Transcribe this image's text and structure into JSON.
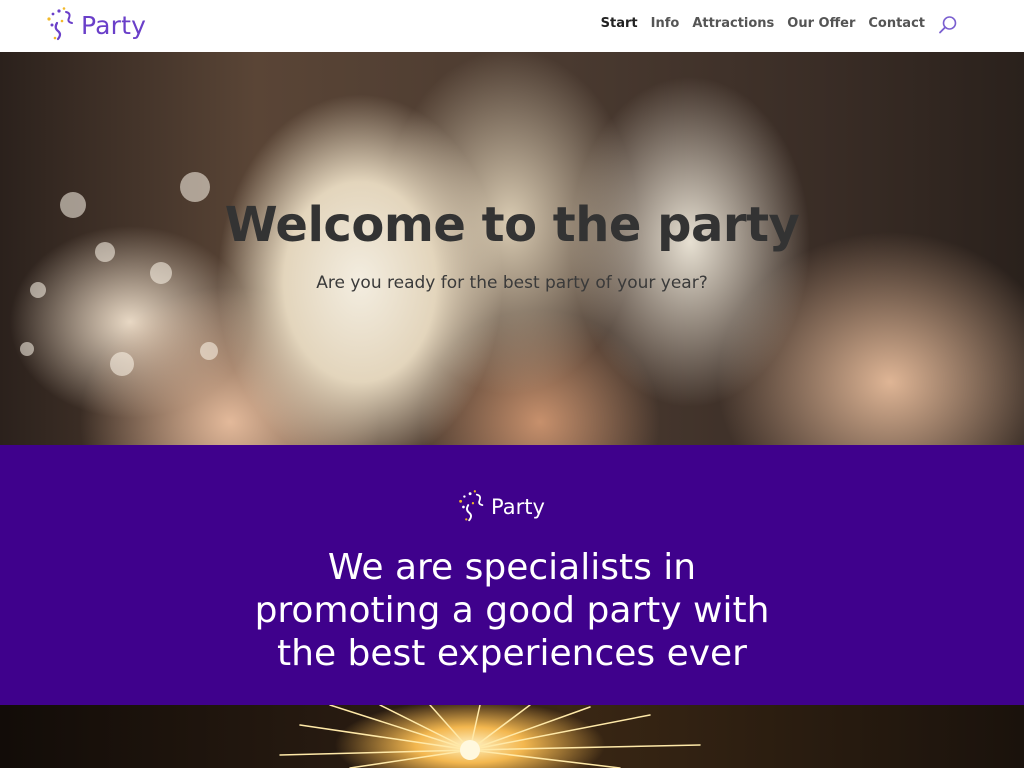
{
  "header": {
    "logo_text": "Party",
    "nav": [
      {
        "label": "Start",
        "active": true
      },
      {
        "label": "Info",
        "active": false
      },
      {
        "label": "Attractions",
        "active": false
      },
      {
        "label": "Our Offer",
        "active": false
      },
      {
        "label": "Contact",
        "active": false
      }
    ],
    "search_icon": "search-icon"
  },
  "hero": {
    "title": "Welcome to the party",
    "subtitle": "Are you ready for the best party of your year?"
  },
  "band": {
    "logo_text": "Party",
    "heading_lines": [
      "We are specialists in",
      "promoting a good party with",
      "the best experiences ever"
    ]
  },
  "colors": {
    "brand_purple": "#6a3fc9",
    "band_background": "#3f018c",
    "nav_text": "#555555",
    "nav_active": "#222222"
  }
}
